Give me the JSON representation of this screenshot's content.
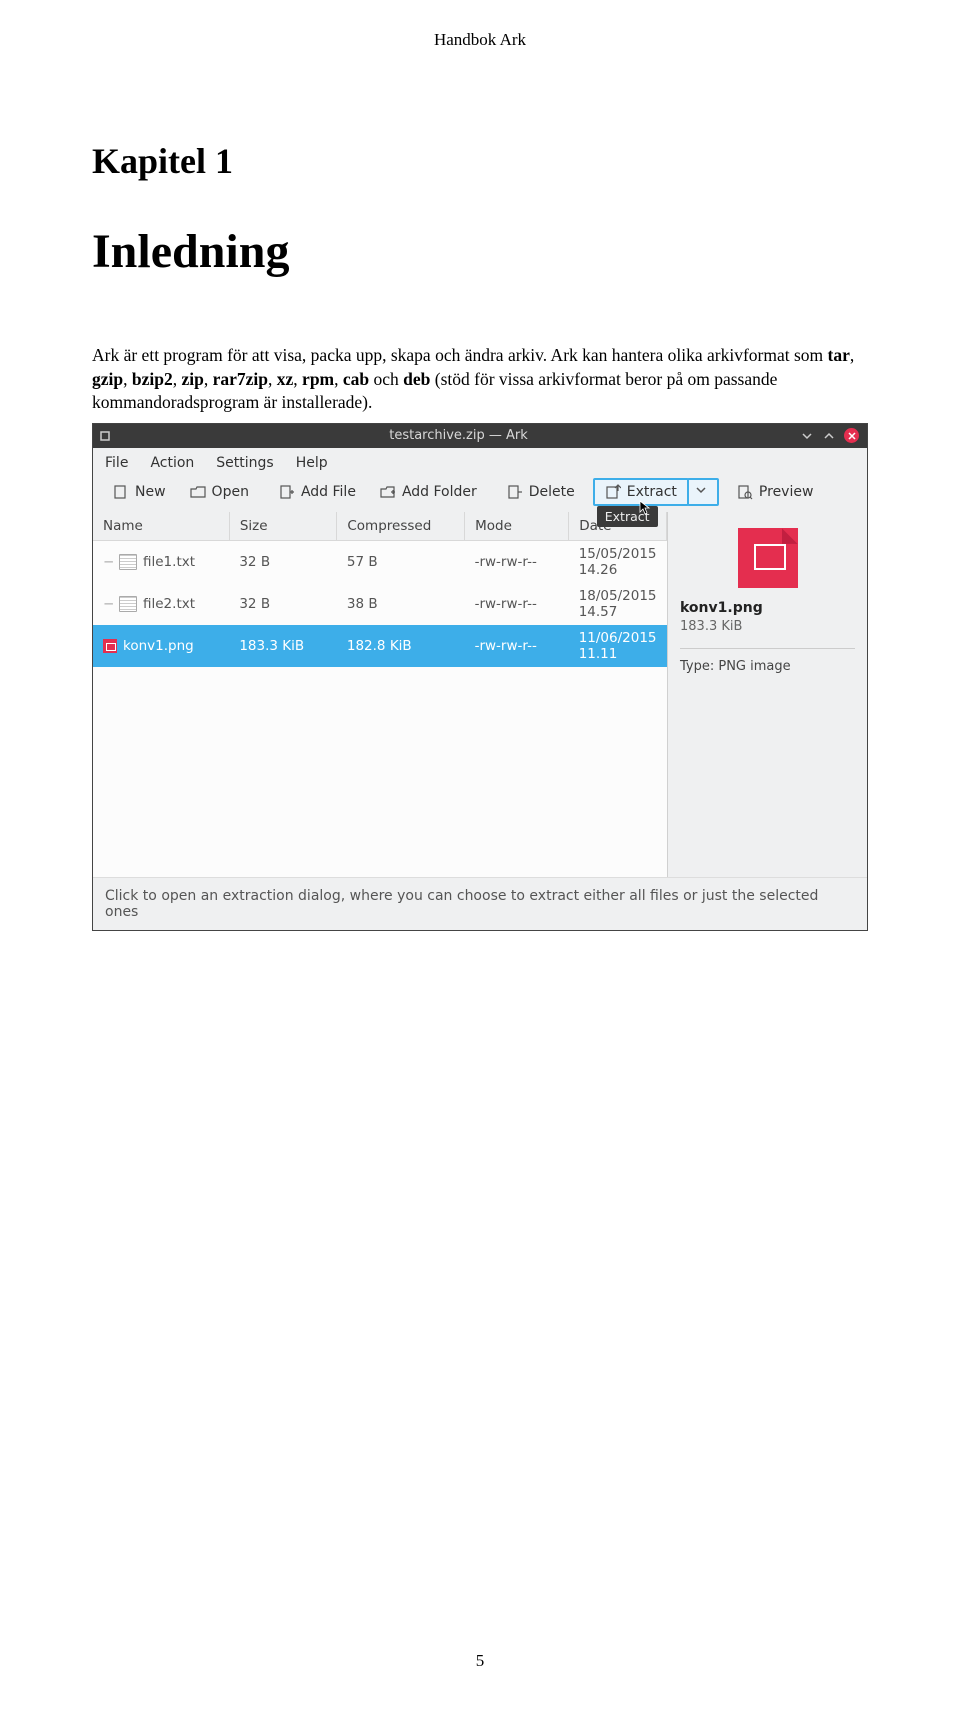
{
  "doc": {
    "header": "Handbok Ark",
    "chapter": "Kapitel 1",
    "title": "Inledning",
    "para1_a": "Ark är ett program för att visa, packa upp, skapa och ändra arkiv. Ark kan hantera olika arkivformat som ",
    "para1_b1": "tar",
    "para1_c1": ", ",
    "para1_b2": "gzip",
    "para1_c2": ", ",
    "para1_b3": "bzip2",
    "para1_c3": ", ",
    "para1_b4": "zip",
    "para1_c4": ", ",
    "para1_b5": "rar7zip",
    "para1_c5": ", ",
    "para1_b6": "xz",
    "para1_c6": ", ",
    "para1_b7": "rpm",
    "para1_c7": ", ",
    "para1_b8": "cab",
    "para1_c8": " och ",
    "para1_b9": "deb",
    "para1_d": " (stöd för vissa arkivformat beror på om passande kommandoradsprogram är installerade).",
    "page_num": "5"
  },
  "win": {
    "title": "testarchive.zip — Ark",
    "menu": {
      "file": "File",
      "action": "Action",
      "settings": "Settings",
      "help": "Help"
    },
    "tb": {
      "new": "New",
      "open": "Open",
      "addfile": "Add File",
      "addfolder": "Add Folder",
      "delete": "Delete",
      "extract": "Extract",
      "preview": "Preview"
    },
    "tooltip": "Extract",
    "cols": {
      "name": "Name",
      "size": "Size",
      "compressed": "Compressed",
      "mode": "Mode",
      "date": "Date"
    },
    "rows": [
      {
        "name": "file1.txt",
        "size": "32 B",
        "comp": "57 B",
        "mode": "-rw-rw-r--",
        "date": "15/05/2015 14.26"
      },
      {
        "name": "file2.txt",
        "size": "32 B",
        "comp": "38 B",
        "mode": "-rw-rw-r--",
        "date": "18/05/2015 14.57"
      },
      {
        "name": "konv1.png",
        "size": "183.3 KiB",
        "comp": "182.8 KiB",
        "mode": "-rw-rw-r--",
        "date": "11/06/2015 11.11"
      }
    ],
    "preview": {
      "name": "konv1.png",
      "size": "183.3 KiB",
      "type": "Type: PNG image"
    },
    "status": "Click to open an extraction dialog, where you can choose to extract either all files or just the selected ones"
  }
}
